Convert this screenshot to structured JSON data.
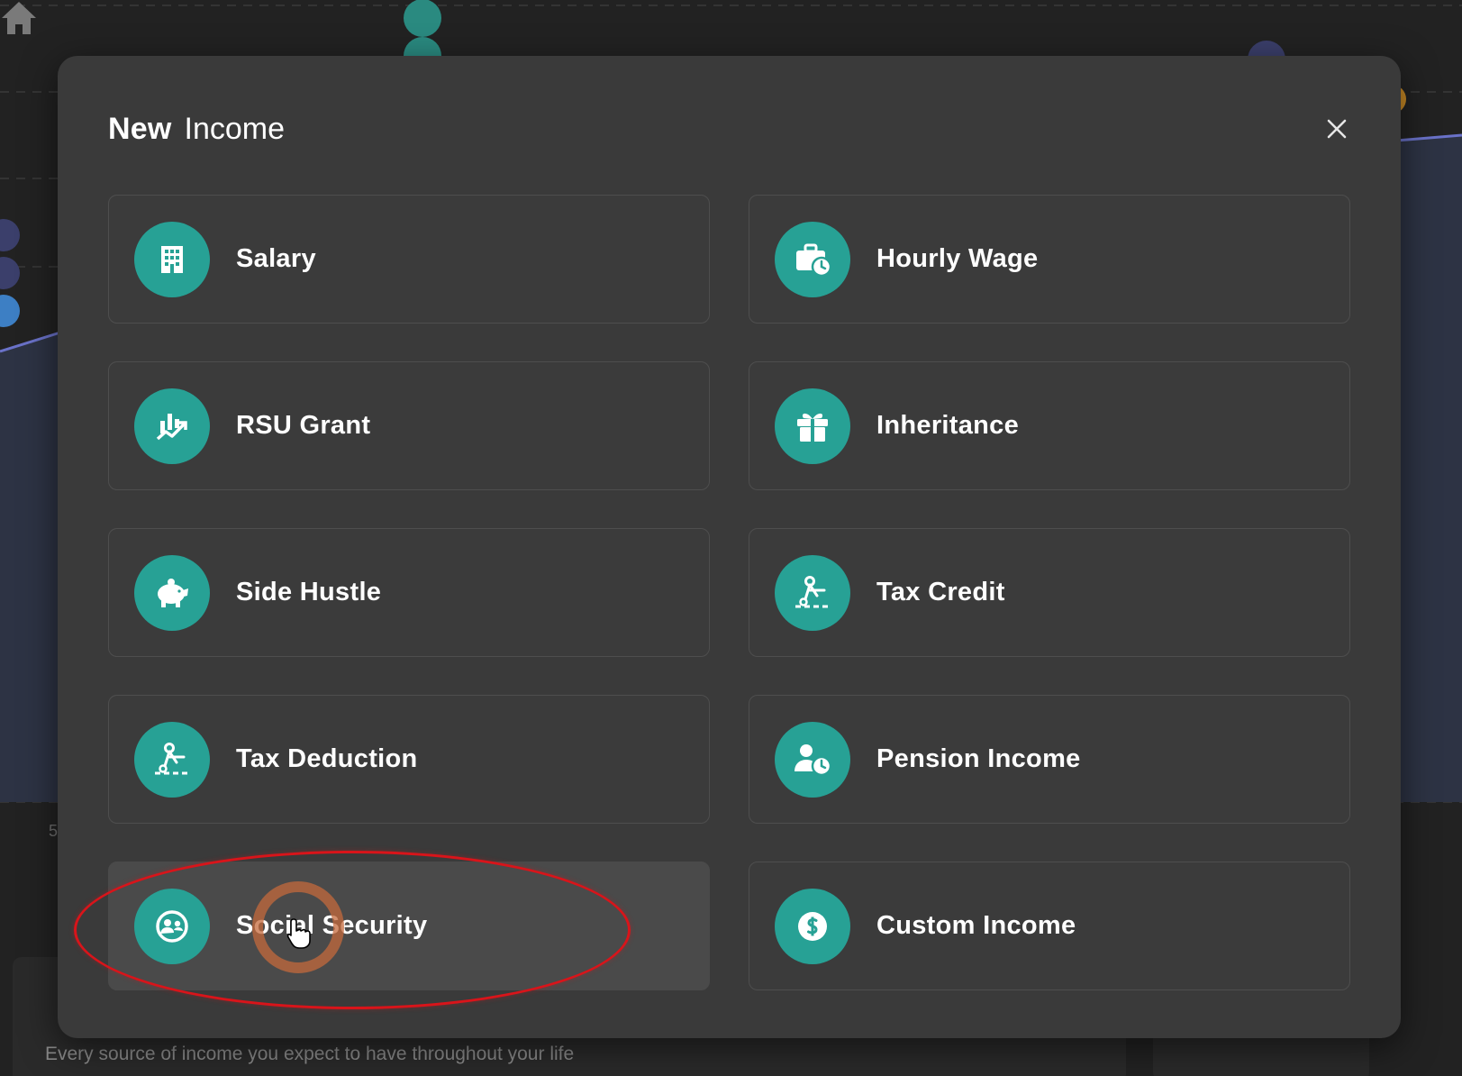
{
  "modal": {
    "title_bold": "New",
    "title_light": "Income",
    "close_icon": "close-icon",
    "options": [
      {
        "label": "Salary",
        "icon": "building-icon"
      },
      {
        "label": "Hourly Wage",
        "icon": "briefcase-clock-icon"
      },
      {
        "label": "RSU Grant",
        "icon": "chart-trend-icon"
      },
      {
        "label": "Inheritance",
        "icon": "gift-icon"
      },
      {
        "label": "Side Hustle",
        "icon": "piggy-bank-icon"
      },
      {
        "label": "Tax Credit",
        "icon": "scissors-coupon-icon"
      },
      {
        "label": "Tax Deduction",
        "icon": "scissors-coupon-icon"
      },
      {
        "label": "Pension Income",
        "icon": "person-clock-icon"
      },
      {
        "label": "Social Security",
        "icon": "people-circle-icon"
      },
      {
        "label": "Custom Income",
        "icon": "dollar-circle-icon"
      }
    ],
    "accent_color": "#27a195",
    "hovered_option": "Social Security"
  },
  "background": {
    "footer_text": "Every source of income you expect to have throughout your life",
    "axis_label": "5"
  },
  "annotation": {
    "color": "#d9141a"
  }
}
